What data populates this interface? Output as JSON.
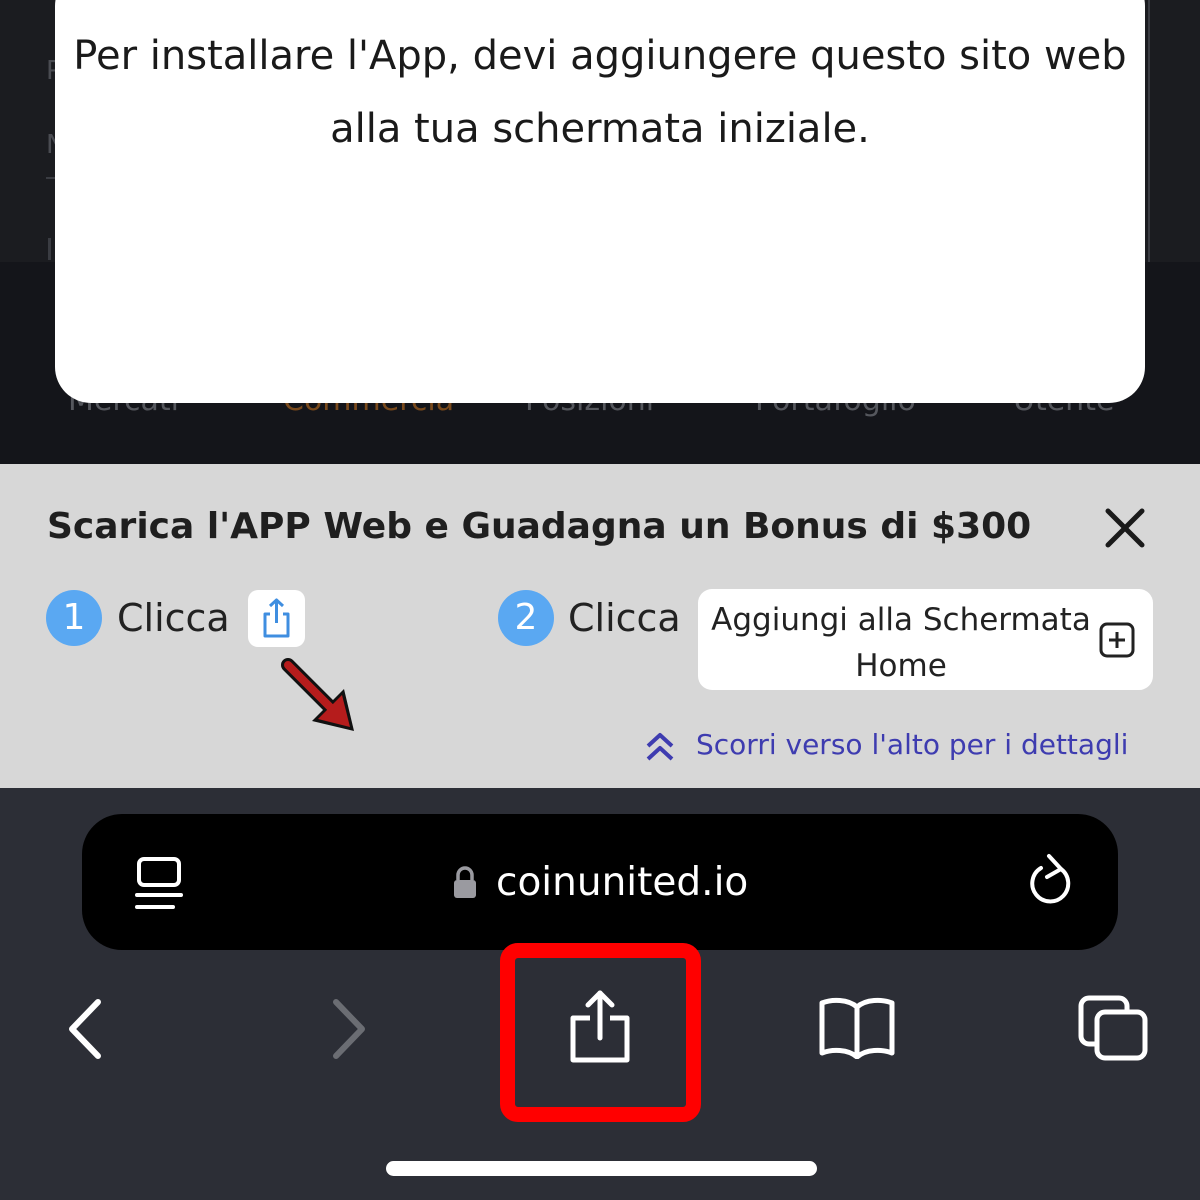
{
  "modal": {
    "message": "Per installare l'App, devi aggiungere questo sito web alla tua schermata iniziale."
  },
  "background_tabs": [
    "Mercati",
    "Commercia",
    "Posizioni",
    "Portafoglio",
    "Utente"
  ],
  "colors": {
    "active_tab": "#9a5a1c",
    "step_circle": "#5aa8f2",
    "scroll_hint": "#3e3cb0",
    "highlight": "#ff0000",
    "arrow": "#b51c1c"
  },
  "banner": {
    "title": "Scarica l'APP Web e Guadagna un Bonus di $300",
    "close_icon": "close-icon",
    "step1": {
      "number": "1",
      "label": "Clicca",
      "icon": "share-icon"
    },
    "step2": {
      "number": "2",
      "label": "Clicca",
      "action_label": "Aggiungi alla Schermata Home",
      "icon": "add-square-icon"
    },
    "scroll_hint": "Scorri verso l'alto per i dettagli"
  },
  "browser": {
    "url": "coinunited.io",
    "icons": [
      "reader-menu-icon",
      "lock-icon",
      "reload-icon"
    ]
  },
  "toolbar": {
    "icons": [
      "back-icon",
      "forward-icon",
      "share-icon",
      "bookmarks-icon",
      "tabs-icon"
    ]
  }
}
